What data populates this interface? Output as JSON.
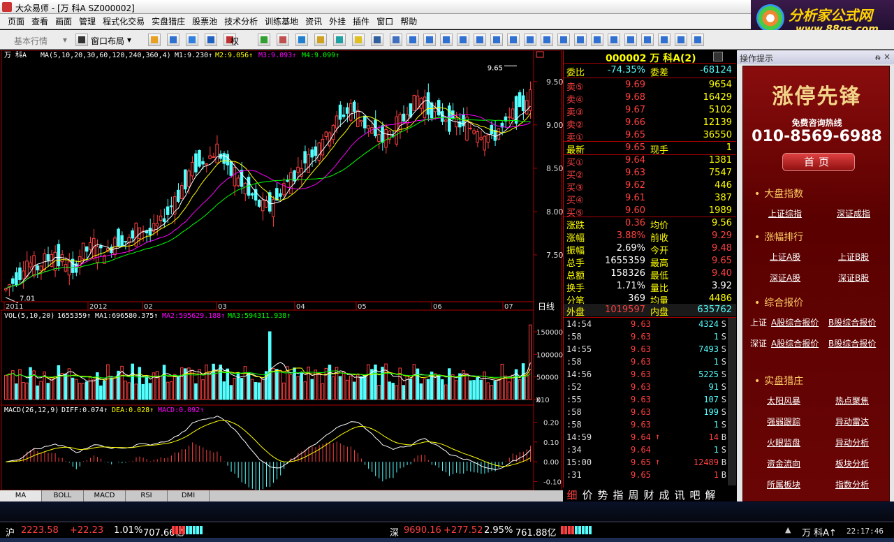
{
  "window": {
    "title": "大众易师 - [万 科A SZ000002]",
    "controls": [
      "_",
      "□",
      "×"
    ]
  },
  "menu": [
    "页面",
    "查看",
    "画面",
    "管理",
    "程式化交易",
    "实盘猎庄",
    "股票池",
    "技术分析",
    "训练基地",
    "资讯",
    "外挂",
    "插件",
    "窗口",
    "帮助"
  ],
  "banner": {
    "brand": "分析家公式网",
    "site": "www.88gs.com"
  },
  "toolbar": {
    "basic_quote": "基本行情",
    "window_layout": "窗口布局",
    "rights": "权"
  },
  "chart": {
    "stock_name": "万 科A",
    "ma_label": "MA(5,10,20,30,60,120,240,360,4)",
    "m1": "M1:9.230↑",
    "m2": "M2:9.056↑",
    "m3": "M3:9.093↑",
    "m4": "M4:9.099↑",
    "price_ticks": [
      "9.50",
      "9.00",
      "8.50",
      "8.00",
      "7.50"
    ],
    "high_mark": "9.65",
    "low_mark": "7.01",
    "date_labels": [
      "2011",
      "2012",
      "02",
      "03",
      "04",
      "05",
      "06",
      "07"
    ],
    "period": "日线",
    "vol_label": "VOL(5,10,20)",
    "vol_value": "1655359↑",
    "vol_ma1": "MA1:696580.375↑",
    "vol_ma2": "MA2:595629.188↑",
    "vol_ma3": "MA3:594311.938↑",
    "vol_ticks": [
      "150000",
      "100000",
      "50000",
      "0"
    ],
    "vol_unit": "X10",
    "macd_label": "MACD(26,12,9)",
    "diff": "DIFF:0.074↑",
    "dea": "DEA:0.028↑",
    "macd": "MACD:0.092↑",
    "macd_ticks": [
      "0.20",
      "0.10",
      "0.00",
      "-0.10"
    ],
    "indicator_tabs": [
      "MA",
      "BOLL",
      "MACD",
      "RSI",
      "DMI"
    ]
  },
  "chart_data": {
    "type": "candlestick",
    "title": "万 科A",
    "ylim": [
      7.0,
      9.7
    ],
    "y_ticks": [
      7.5,
      8.0,
      8.5,
      9.0,
      9.5
    ],
    "x_labels": [
      "2011",
      "2012",
      "02",
      "03",
      "04",
      "05",
      "06",
      "07"
    ],
    "high": 9.65,
    "low": 7.01,
    "close_trend": [
      7.1,
      7.25,
      7.4,
      7.35,
      7.5,
      7.45,
      7.3,
      7.55,
      7.6,
      7.5,
      7.7,
      7.65,
      7.8,
      7.75,
      7.9,
      8.1,
      8.3,
      8.55,
      8.6,
      8.7,
      8.5,
      8.35,
      8.2,
      8.05,
      8.1,
      8.3,
      8.45,
      8.6,
      8.75,
      8.9,
      9.1,
      9.2,
      9.05,
      8.9,
      8.85,
      8.95,
      9.15,
      9.3,
      9.2,
      9.1,
      9.05,
      9.0,
      8.95,
      8.85,
      8.9,
      9.05,
      9.2,
      9.3
    ],
    "volume_ylim": [
      0,
      170000
    ],
    "macd_ylim": [
      -0.13,
      0.23
    ]
  },
  "quote": {
    "header": "000002 万 科A(2)",
    "weibi_label": "委比",
    "weibi": "-74.35%",
    "weicha_label": "委差",
    "weicha": "-68124",
    "asks": [
      {
        "label": "卖⑤",
        "price": "9.69",
        "vol": "9654"
      },
      {
        "label": "卖④",
        "price": "9.68",
        "vol": "16429"
      },
      {
        "label": "卖③",
        "price": "9.67",
        "vol": "5102"
      },
      {
        "label": "卖②",
        "price": "9.66",
        "vol": "12139"
      },
      {
        "label": "卖①",
        "price": "9.65",
        "vol": "36550"
      }
    ],
    "last_label": "最新",
    "last": "9.65",
    "now_label": "现手",
    "now": "1",
    "bids": [
      {
        "label": "买①",
        "price": "9.64",
        "vol": "1381"
      },
      {
        "label": "买②",
        "price": "9.63",
        "vol": "7547"
      },
      {
        "label": "买③",
        "price": "9.62",
        "vol": "446"
      },
      {
        "label": "买④",
        "price": "9.61",
        "vol": "387"
      },
      {
        "label": "买⑤",
        "price": "9.60",
        "vol": "1989"
      }
    ],
    "stats": [
      {
        "l1": "涨跌",
        "v1": "0.36",
        "l2": "均价",
        "v2": "9.56"
      },
      {
        "l1": "涨幅",
        "v1": "3.88%",
        "l2": "前收",
        "v2": "9.29"
      },
      {
        "l1": "振幅",
        "v1": "2.69%",
        "l2": "今开",
        "v2": "9.48"
      },
      {
        "l1": "总手",
        "v1": "1655359",
        "l2": "最高",
        "v2": "9.65"
      },
      {
        "l1": "总额",
        "v1": "158326",
        "l2": "最低",
        "v2": "9.40"
      },
      {
        "l1": "换手",
        "v1": "1.71%",
        "l2": "量比",
        "v2": "3.92"
      },
      {
        "l1": "分笔",
        "v1": "369",
        "l2": "均量",
        "v2": "4486"
      }
    ],
    "outer_label": "外盘",
    "outer": "1019597",
    "inner_label": "内盘",
    "inner": "635762",
    "ticks": [
      {
        "time": "14:54",
        "price": "9.63",
        "up": false,
        "vol": "4324",
        "bs": "S"
      },
      {
        "time": ":58",
        "price": "9.63",
        "up": false,
        "vol": "1",
        "bs": "S"
      },
      {
        "time": "14:55",
        "price": "9.63",
        "up": false,
        "vol": "7493",
        "bs": "S"
      },
      {
        "time": ":58",
        "price": "9.63",
        "up": false,
        "vol": "1",
        "bs": "S"
      },
      {
        "time": "14:56",
        "price": "9.63",
        "up": false,
        "vol": "5225",
        "bs": "S"
      },
      {
        "time": ":52",
        "price": "9.63",
        "up": false,
        "vol": "91",
        "bs": "S"
      },
      {
        "time": ":55",
        "price": "9.63",
        "up": false,
        "vol": "107",
        "bs": "S"
      },
      {
        "time": ":58",
        "price": "9.63",
        "up": false,
        "vol": "199",
        "bs": "S"
      },
      {
        "time": ":58",
        "price": "9.63",
        "up": false,
        "vol": "1",
        "bs": "S"
      },
      {
        "time": "14:59",
        "price": "9.64",
        "up": true,
        "vol": "14",
        "bs": "B"
      },
      {
        "time": ":34",
        "price": "9.64",
        "up": false,
        "vol": "1",
        "bs": "S"
      },
      {
        "time": "15:00",
        "price": "9.65",
        "up": true,
        "vol": "12489",
        "bs": "B"
      },
      {
        "time": ":31",
        "price": "9.65",
        "up": false,
        "vol": "1",
        "bs": "B"
      }
    ],
    "detail_tabs": [
      "细",
      "价",
      "势",
      "指",
      "周",
      "财",
      "成",
      "讯",
      "吧",
      "解"
    ]
  },
  "side": {
    "title": "操作提示",
    "pin": "ᵰ",
    "close": "×",
    "hero": "涨停先锋",
    "hotline_label": "免费咨询热线",
    "hotline": "010-8569-6988",
    "home": "首页",
    "sections": [
      {
        "title": "大盘指数",
        "links": [
          "上证综指",
          "深证成指"
        ]
      },
      {
        "title": "涨幅排行",
        "links": [
          "上证A股",
          "上证B股",
          "深证A股",
          "深证B股"
        ]
      },
      {
        "title": "综合报价",
        "rows": [
          {
            "market": "上证",
            "a": "A股综合报价",
            "b": "B股综合报价"
          },
          {
            "market": "深证",
            "a": "A股综合报价",
            "b": "B股综合报价"
          }
        ]
      },
      {
        "title": "实盘猎庄",
        "links": [
          "太阳风暴",
          "热点聚焦",
          "强弱跟踪",
          "异动雷达",
          "火眼监盘",
          "异动分析",
          "资金流向",
          "板块分析",
          "所属板块",
          "指数分析"
        ]
      }
    ]
  },
  "status": {
    "sh_label": "沪",
    "sh_index": "2223.58",
    "sh_change": "+22.23",
    "sh_pct": "1.01%",
    "sh_amount": "707.66亿",
    "sz_label": "深",
    "sz_index": "9690.16",
    "sz_change": "+277.52",
    "sz_pct": "2.95%",
    "sz_amount": "761.88亿",
    "stock": "万 科A↑",
    "time": "22:17:46"
  },
  "colors": {
    "up": "#ff4040",
    "down": "#54ffff",
    "white": "#ffffff",
    "yellow": "#ffff00",
    "magenta": "#ff00ff",
    "green": "#00ff00",
    "grid_red": "#b00000"
  }
}
